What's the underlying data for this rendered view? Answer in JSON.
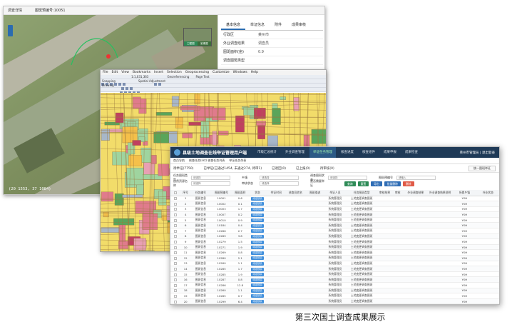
{
  "window1": {
    "tab_label": "调查详情",
    "plot_id_label": "图斑预编号:10051",
    "coords": "(20 1553, 37 1084)",
    "inset_tabs": [
      "卫星图",
      "影像图"
    ],
    "tabs": [
      "基本信息",
      "举证信息",
      "附件",
      "成果审核"
    ],
    "attributes": [
      {
        "key": "行政区",
        "value": "莱州市"
      },
      {
        "key": "外业调查结果",
        "value": "调查员"
      },
      {
        "key": "图斑面积(亩)",
        "value": "0.9"
      },
      {
        "key": "调查图斑类型",
        "value": ""
      }
    ]
  },
  "window2": {
    "menu": [
      "File",
      "Edit",
      "View",
      "Bookmarks",
      "Insert",
      "Selection",
      "Geoprocessing",
      "Customize",
      "Windows",
      "Help"
    ],
    "scale": "1:1,031,363",
    "georeferencing_label": "Georeferencing",
    "snapping_label": "Snapping",
    "drawing_label": "Drawing",
    "spatial_label": "Spatial Adjustment",
    "page_text_label": "Page Text"
  },
  "window3": {
    "title": "县级土地调查在线举证管理用户端",
    "nav": [
      "市级汇总统计",
      "外业调查管理",
      "举证任务管理",
      "核查进度",
      "核查组件",
      "成果申报",
      "成果检查"
    ],
    "active_nav": 2,
    "user": "莱州市管理员 | 退出登录",
    "breadcrumb": [
      "首页导航",
      "核查任务(list) 核查任务列表",
      "举证任务列表"
    ],
    "stats": [
      "待举证(7750)",
      "已举证(已通过1454, 未通过274, 待审1)",
      "已退回(0)",
      "已上报(0)",
      "待审核(0)"
    ],
    "stats_right": "统一图斑举证",
    "filters": [
      [
        {
          "label": "任务图斑类型",
          "value": "请选择"
        },
        {
          "label": "乡镇",
          "value": "请选择"
        },
        {
          "label": "调查图斑状态",
          "value": "请选择"
        },
        {
          "label": "图斑预编号",
          "value": "请输入"
        }
      ],
      [
        {
          "label": "自然资源名称",
          "value": "请选择"
        },
        {
          "label": "审核状态",
          "value": "请选择"
        },
        {
          "label": "是否需要举证",
          "value": ""
        },
        {
          "label": "",
          "value": ""
        }
      ]
    ],
    "buttons": [
      "查询",
      "重置",
      "导出",
      "批量删除",
      "删除"
    ],
    "columns": [
      "",
      "序号",
      "任务编号",
      "图斑预编号",
      "图斑面积",
      "状态",
      "举证时间",
      "核查员姓名",
      "图斑描述",
      "举证人员",
      "任务图斑类型",
      "审核结果",
      "审核",
      "外业调查结果",
      "外业调查结果说明",
      "所属乡镇",
      "外业状态"
    ],
    "rows": [
      [
        "1",
        "图斑信息",
        "10001",
        "0.6",
        "待定核实"
      ],
      [
        "2",
        "图斑信息",
        "10002",
        "0.1",
        "待定核实"
      ],
      [
        "3",
        "图斑信息",
        "10003",
        "1.7",
        "待定核实"
      ],
      [
        "4",
        "图斑信息",
        "10007",
        "0.2",
        "待定核实"
      ],
      [
        "5",
        "图斑信息",
        "10010",
        "0.9",
        "待定核实"
      ],
      [
        "6",
        "图斑信息",
        "10184",
        "0.4",
        "待定核实"
      ],
      [
        "7",
        "图斑信息",
        "10286",
        "2.7",
        "待定核实"
      ],
      [
        "8",
        "图斑信息",
        "10289",
        "3.8",
        "待定核实"
      ],
      [
        "9",
        "图斑信息",
        "10279",
        "1.5",
        "待定核实"
      ],
      [
        "10",
        "图斑信息",
        "10271",
        "1.9",
        "待定核实"
      ],
      [
        "11",
        "图斑信息",
        "10269",
        "0.8",
        "待定核实"
      ],
      [
        "12",
        "图斑信息",
        "10280",
        "2.1",
        "待定核实"
      ],
      [
        "13",
        "图斑信息",
        "10260",
        "1.1",
        "待定核实"
      ],
      [
        "14",
        "图斑信息",
        "10285",
        "1.7",
        "待定核实"
      ],
      [
        "15",
        "图斑信息",
        "10285",
        "1.9",
        "待定核实"
      ],
      [
        "16",
        "图斑信息",
        "10287",
        "0.8",
        "待定核实"
      ],
      [
        "17",
        "图斑信息",
        "10286",
        "12.8",
        "待定核实"
      ],
      [
        "18",
        "图斑信息",
        "10260",
        "1.1",
        "待定核实"
      ],
      [
        "19",
        "图斑信息",
        "10285",
        "0.7",
        "待定核实"
      ],
      [
        "20",
        "图斑信息",
        "10299",
        "6.4",
        "待定核实"
      ],
      [
        "21",
        "图斑信息",
        "10285",
        "1.4",
        "待定核实"
      ]
    ],
    "row_person": "系统管理员",
    "row_type": "土地变更调查图斑",
    "row_flag": "Y0H"
  },
  "caption": "第三次国土调查成果展示"
}
